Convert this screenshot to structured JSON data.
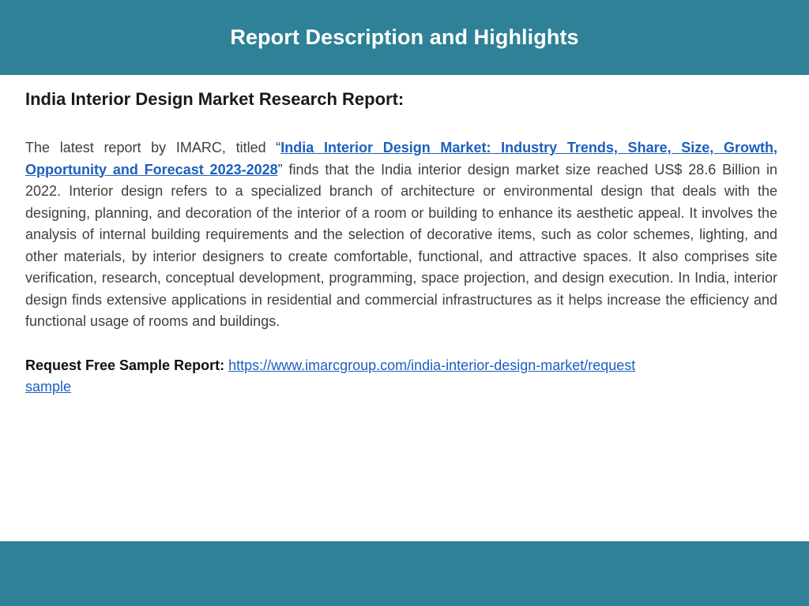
{
  "header": {
    "title": "Report Description and Highlights"
  },
  "content": {
    "heading": "India Interior Design Market Research Report:",
    "intro_prefix": "The latest report by IMARC, titled “",
    "report_title_link": "India Interior Design Market: Industry Trends, Share, Size, Growth, Opportunity and Forecast 2023-2028",
    "intro_suffix": "” finds that the India interior design market size reached US$ 28.6 Billion in 2022. Interior design refers to a specialized branch of architecture or environmental design that deals with the designing, planning, and decoration of the interior of a room or building to enhance its aesthetic appeal. It involves the analysis of internal building requirements and the selection of decorative items, such as color schemes, lighting, and other materials, by interior designers to create comfortable, functional, and attractive spaces. It also comprises site verification, research, conceptual development, programming, space projection, and design execution. In India, interior design finds extensive applications in residential and commercial infrastructures as it helps increase the efficiency and functional usage of rooms and buildings.",
    "request_label": "Request Free Sample Report:",
    "request_url": "https://www.imarcgroup.com/india-interior-design-market/requestsample"
  },
  "colors": {
    "banner": "#2e8196",
    "link": "#1d5fbf",
    "background": "#ffffff"
  }
}
